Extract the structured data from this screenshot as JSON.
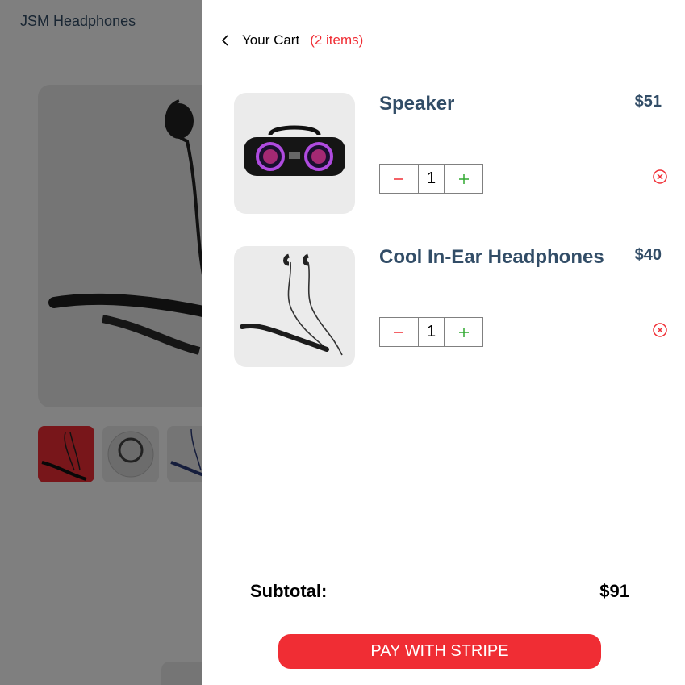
{
  "background": {
    "brand": "JSM Headphones"
  },
  "cart": {
    "title": "Your Cart",
    "item_count": "(2 items)",
    "items": [
      {
        "name": "Speaker",
        "price": "$51",
        "quantity": "1",
        "image": "speaker"
      },
      {
        "name": "Cool In-Ear Headphones",
        "price": "$40",
        "quantity": "1",
        "image": "in-ear-headphones"
      }
    ],
    "subtotal_label": "Subtotal:",
    "subtotal_value": "$91",
    "pay_button": "PAY WITH STRIPE"
  },
  "icons": {
    "back": "chevron-left-icon",
    "minus": "minus-icon",
    "plus": "plus-icon",
    "remove": "close-circle-icon"
  },
  "colors": {
    "accent": "#f02d34",
    "text_dark": "#324d67",
    "plus_green": "#31a831",
    "image_bg": "#ebebeb"
  }
}
